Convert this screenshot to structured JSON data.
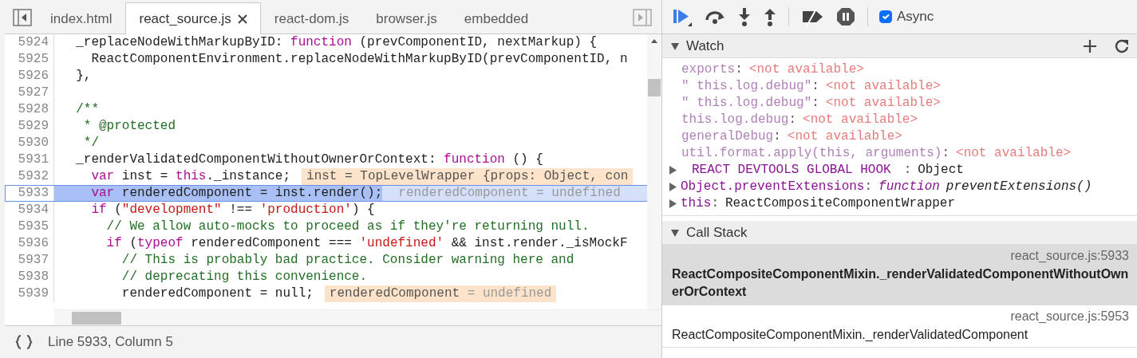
{
  "editor": {
    "tabs": [
      {
        "label": "index.html",
        "selected": false,
        "closable": false
      },
      {
        "label": "react_source.js",
        "selected": true,
        "closable": true
      },
      {
        "label": "react-dom.js",
        "selected": false,
        "closable": false
      },
      {
        "label": "browser.js",
        "selected": false,
        "closable": false
      },
      {
        "label": "embedded",
        "selected": false,
        "closable": false
      }
    ],
    "lines": [
      {
        "number": "5924",
        "paused": false,
        "tokens": [
          {
            "kind": "plain",
            "text": "  _replaceNodeWithMarkupByID: "
          },
          {
            "kind": "keyword",
            "text": "function"
          },
          {
            "kind": "plain",
            "text": " (prevComponentID, nextMarkup) {"
          }
        ]
      },
      {
        "number": "5925",
        "paused": false,
        "tokens": [
          {
            "kind": "plain",
            "text": "    ReactComponentEnvironment.replaceNodeWithMarkupByID(prevComponentID, n"
          }
        ]
      },
      {
        "number": "5926",
        "paused": false,
        "tokens": [
          {
            "kind": "plain",
            "text": "  },"
          }
        ]
      },
      {
        "number": "5927",
        "paused": false
      },
      {
        "number": "5928",
        "paused": false,
        "tokens": [
          {
            "kind": "comment",
            "text": "  /**"
          }
        ]
      },
      {
        "number": "5929",
        "paused": false,
        "tokens": [
          {
            "kind": "comment",
            "text": "   * @protected"
          }
        ]
      },
      {
        "number": "5930",
        "paused": false,
        "tokens": [
          {
            "kind": "comment",
            "text": "   */"
          }
        ]
      },
      {
        "number": "5931",
        "paused": false,
        "tokens": [
          {
            "kind": "plain",
            "text": "  _renderValidatedComponentWithoutOwnerOrContext: "
          },
          {
            "kind": "keyword",
            "text": "function"
          },
          {
            "kind": "plain",
            "text": " () {"
          }
        ]
      },
      {
        "number": "5932",
        "paused": false,
        "tokens": [
          {
            "kind": "keyword",
            "text": "    var"
          },
          {
            "kind": "plain",
            "text": " inst = "
          },
          {
            "kind": "keyword",
            "text": "this"
          },
          {
            "kind": "plain",
            "text": "._instance;"
          }
        ],
        "annotation": {
          "name": "inst",
          "value": "= TopLevelWrapper {props: Object, con",
          "kind": "object"
        }
      },
      {
        "number": "5933",
        "paused": true,
        "tokens": [
          {
            "kind": "keyword",
            "text": "    var"
          },
          {
            "kind": "plain",
            "text": " renderedComponent = inst.render();"
          }
        ],
        "annotation": {
          "name": "renderedComponent",
          "value": "= undefined",
          "kind": "undefined"
        }
      },
      {
        "number": "5934",
        "paused": false,
        "tokens": [
          {
            "kind": "keyword",
            "text": "    if"
          },
          {
            "kind": "plain",
            "text": " ("
          },
          {
            "kind": "string",
            "text": "\"development\""
          },
          {
            "kind": "plain",
            "text": " !== "
          },
          {
            "kind": "string",
            "text": "'production'"
          },
          {
            "kind": "plain",
            "text": ") {"
          }
        ]
      },
      {
        "number": "5935",
        "paused": false,
        "tokens": [
          {
            "kind": "comment",
            "text": "      // We allow auto-mocks to proceed as if they're returning null."
          }
        ]
      },
      {
        "number": "5936",
        "paused": false,
        "tokens": [
          {
            "kind": "keyword",
            "text": "      if"
          },
          {
            "kind": "plain",
            "text": " ("
          },
          {
            "kind": "keyword",
            "text": "typeof"
          },
          {
            "kind": "plain",
            "text": " renderedComponent === "
          },
          {
            "kind": "string",
            "text": "'undefined'"
          },
          {
            "kind": "plain",
            "text": " && inst.render._isMockF"
          }
        ]
      },
      {
        "number": "5937",
        "paused": false,
        "tokens": [
          {
            "kind": "comment",
            "text": "        // This is probably bad practice. Consider warning here and"
          }
        ]
      },
      {
        "number": "5938",
        "paused": false,
        "tokens": [
          {
            "kind": "comment",
            "text": "        // deprecating this convenience."
          }
        ]
      },
      {
        "number": "5939",
        "paused": false,
        "tokens": [
          {
            "kind": "plain",
            "text": "        renderedComponent = null;"
          }
        ],
        "annotation": {
          "name": "renderedComponent",
          "value": "= undefined",
          "kind": "undefined"
        }
      }
    ],
    "status": "Line 5933, Column 5"
  },
  "debugger": {
    "async": {
      "label": "Async",
      "checked": true
    },
    "watch": {
      "title": "Watch",
      "expanded": true,
      "items": [
        {
          "kind": "unavailable",
          "name": "exports",
          "separator": ":",
          "value": "<not available>"
        },
        {
          "kind": "unavailable",
          "name": "\" this.log.debug\"",
          "separator": ":",
          "value": "<not available>"
        },
        {
          "kind": "unavailable",
          "name": "\" this.log.debug\"",
          "separator": ":",
          "value": "<not available>"
        },
        {
          "kind": "unavailable",
          "name": "this.log.debug",
          "separator": ":",
          "value": "<not available>"
        },
        {
          "kind": "unavailable",
          "name": "generalDebug",
          "separator": ":",
          "value": "<not available>"
        },
        {
          "kind": "unavailable",
          "name": "util.format.apply(this, arguments)",
          "separator": ":",
          "value": "<not available>"
        },
        {
          "kind": "object",
          "name": "REACT DEVTOOLS GLOBAL HOOK",
          "separator": ":",
          "value": "Object",
          "expanded": false
        },
        {
          "kind": "function",
          "name": "Object.preventExtensions",
          "separator": ":",
          "type_word": "function",
          "value": "preventExtensions()",
          "expanded": false
        },
        {
          "kind": "object",
          "name": "this",
          "separator": ":",
          "value": "ReactCompositeComponentWrapper",
          "expanded": false
        }
      ]
    },
    "call_stack": {
      "title": "Call Stack",
      "expanded": true,
      "frames": [
        {
          "location": "react_source.js:5933",
          "function": "ReactCompositeComponentMixin._renderValidatedComponentWithoutOwnerOrContext",
          "selected": true
        },
        {
          "location": "react_source.js:5953",
          "function": "ReactCompositeComponentMixin._renderValidatedComponent",
          "selected": false
        }
      ]
    }
  }
}
